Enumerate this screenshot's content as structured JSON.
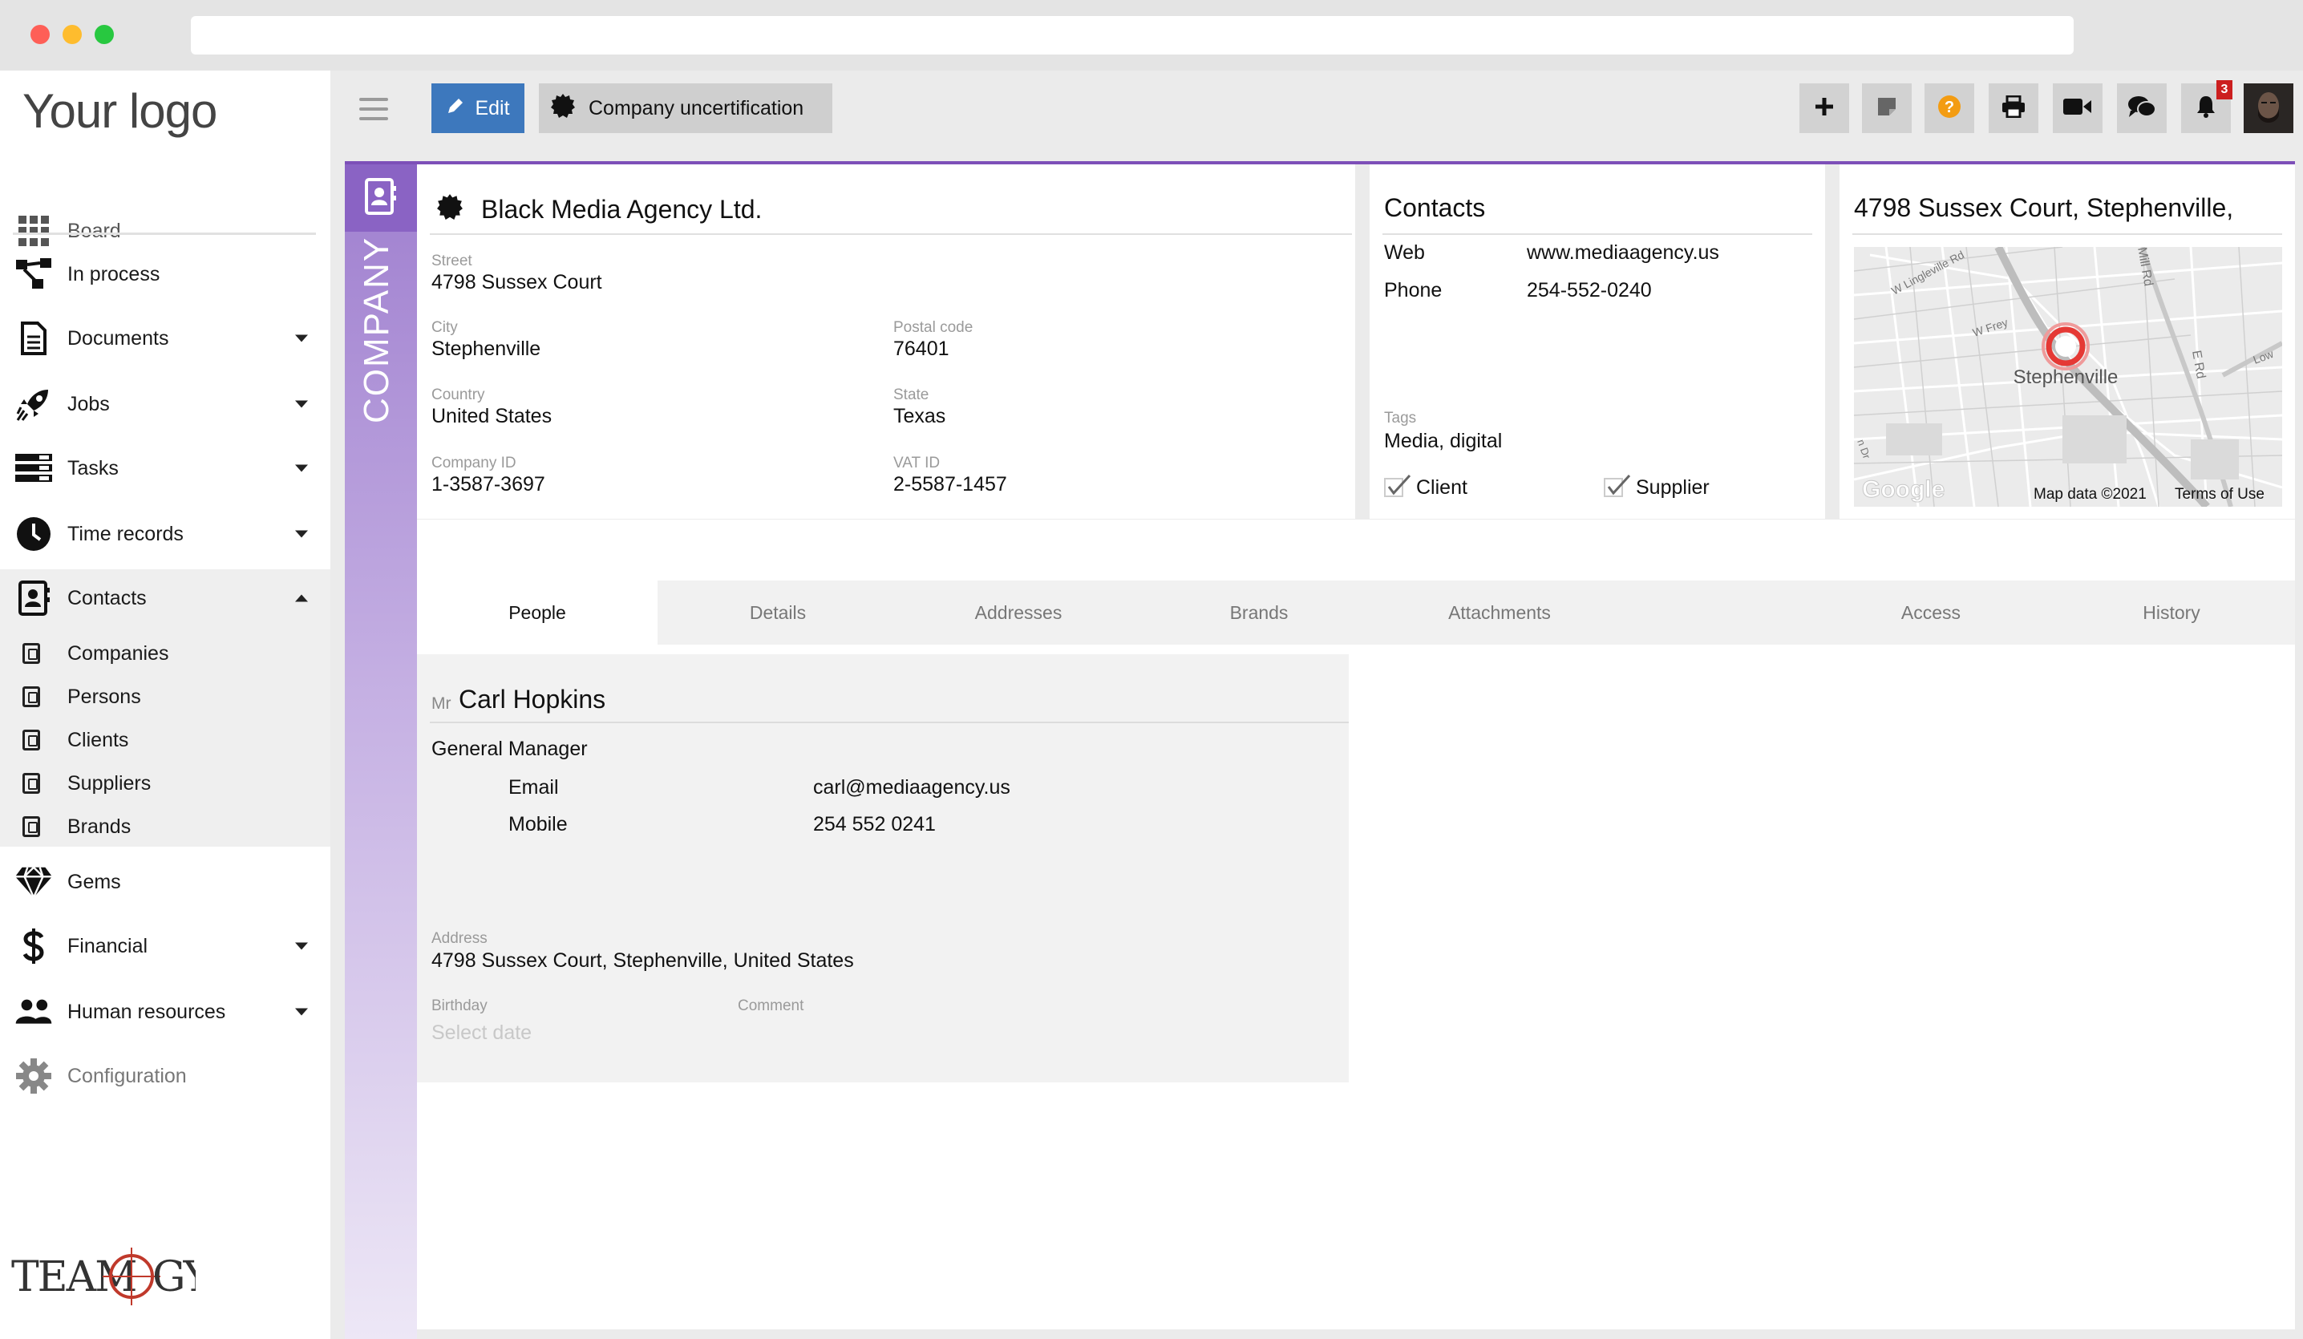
{
  "window": {},
  "logo": {
    "text": "Your logo"
  },
  "sidebar": {
    "items": [
      {
        "label": "Board",
        "icon": "grid-icon"
      },
      {
        "label": "In process",
        "icon": "flow-icon"
      },
      {
        "label": "Documents",
        "icon": "document-icon"
      },
      {
        "label": "Jobs",
        "icon": "rocket-icon"
      },
      {
        "label": "Tasks",
        "icon": "tasks-icon"
      },
      {
        "label": "Time records",
        "icon": "clock-icon"
      },
      {
        "label": "Contacts",
        "icon": "contacts-icon"
      },
      {
        "label": "Gems",
        "icon": "diamond-icon"
      },
      {
        "label": "Financial",
        "icon": "dollar-icon"
      },
      {
        "label": "Human resources",
        "icon": "people-icon"
      },
      {
        "label": "Configuration",
        "icon": "gear-icon"
      }
    ],
    "contacts_sub": [
      "Companies",
      "Persons",
      "Clients",
      "Suppliers",
      "Brands"
    ],
    "footer_logo": "TEAMOGY"
  },
  "toolbar": {
    "edit_label": "Edit",
    "uncertification_label": "Company uncertification",
    "notification_count": "3",
    "icons": [
      "plus-icon",
      "note-icon",
      "help-icon",
      "print-icon",
      "video-icon",
      "chat-icon",
      "bell-icon"
    ]
  },
  "record": {
    "side_label": "COMPANY",
    "company": {
      "name": "Black Media Agency Ltd.",
      "street_label": "Street",
      "street": "4798  Sussex Court",
      "city_label": "City",
      "city": "Stephenville",
      "postal_label": "Postal code",
      "postal": "76401",
      "country_label": "Country",
      "country": "United States",
      "state_label": "State",
      "state": "Texas",
      "company_id_label": "Company ID",
      "company_id": "1-3587-3697",
      "vat_label": "VAT ID",
      "vat": "2-5587-1457"
    },
    "contacts": {
      "title": "Contacts",
      "web_label": "Web",
      "web": "www.mediaagency.us",
      "phone_label": "Phone",
      "phone": "254-552-0240",
      "tags_label": "Tags",
      "tags": "Media, digital",
      "client_label": "Client",
      "supplier_label": "Supplier"
    },
    "map": {
      "title": "4798 Sussex Court, Stephenville,",
      "city_label": "Stephenville",
      "road1": "W Lingleville Rd",
      "road2": "W Frey",
      "road3": "Mill Rd",
      "road4": "E Rd",
      "road5": "Low",
      "road6": "n Dr",
      "google": "Google",
      "map_data": "Map data ©2021",
      "terms": "Terms of Use"
    }
  },
  "tabs": [
    "People",
    "Details",
    "Addresses",
    "Brands",
    "Attachments",
    "Access",
    "History"
  ],
  "person": {
    "salutation": "Mr",
    "name": "Carl Hopkins",
    "position": "General Manager",
    "email_label": "Email",
    "email": "carl@mediaagency.us",
    "mobile_label": "Mobile",
    "mobile": "254 552 0241",
    "address_label": "Address",
    "address": "4798 Sussex Court, Stephenville, United States",
    "birthday_label": "Birthday",
    "birthday_placeholder": "Select date",
    "comment_label": "Comment"
  },
  "colors": {
    "accent_purple": "#7d4fb8",
    "edit_blue": "#3d78bd",
    "help_orange": "#f39c12",
    "badge_red": "#cc1f1f",
    "map_marker": "#e53935"
  }
}
